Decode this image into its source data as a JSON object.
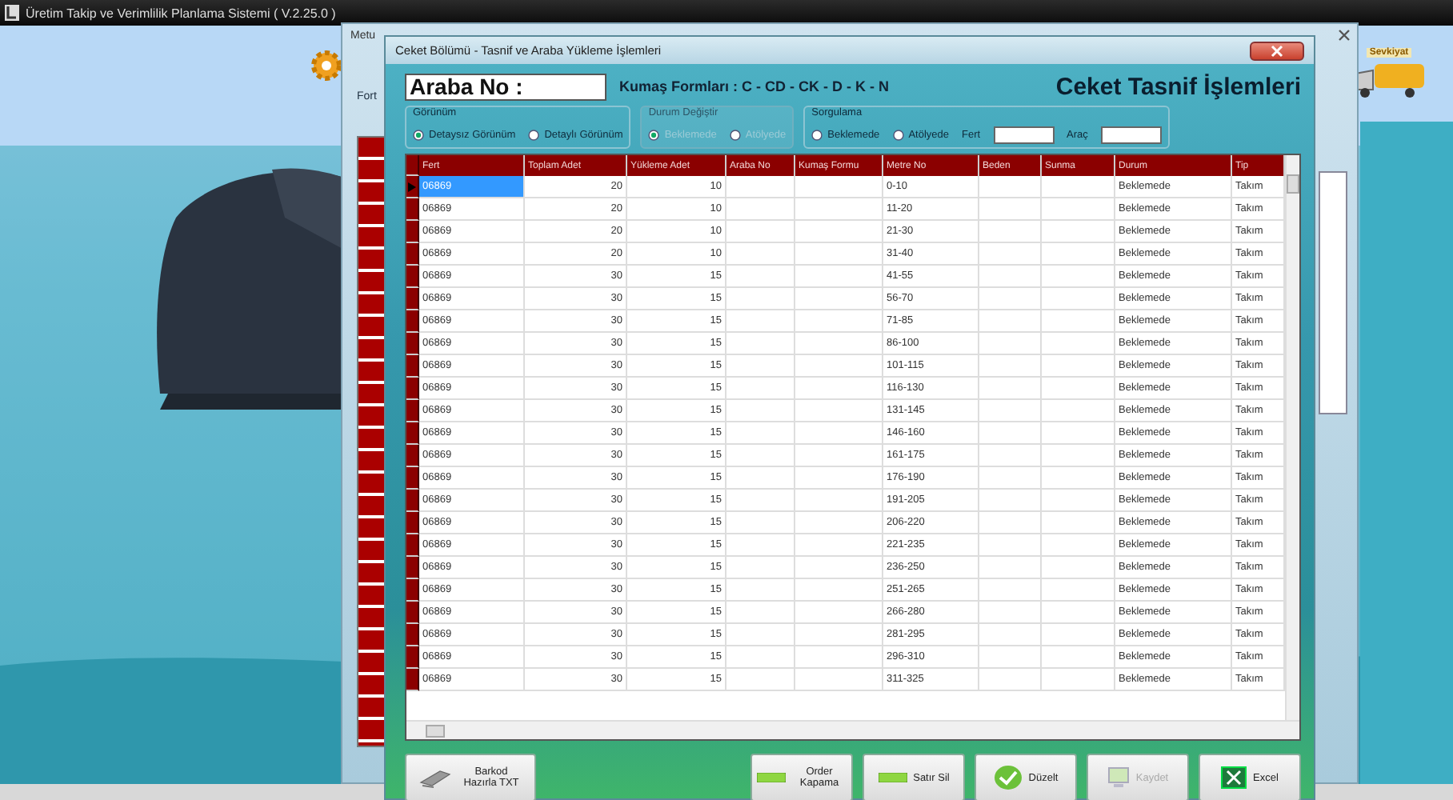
{
  "app_title": "Üretim Takip ve Verimlilik Planlama Sistemi ( V.2.25.0 )",
  "background_window": {
    "title": "Metu",
    "field_label": "Fort"
  },
  "shortcut": {
    "label": "Sevkiyat"
  },
  "dialog": {
    "title": "Ceket Bölümü - Tasnif ve Araba Yükleme İşlemleri",
    "cart_label": "Araba No :",
    "fabric_forms": "Kumaş Formları : C - CD - CK - D - K - N",
    "heading": "Ceket Tasnif İşlemleri"
  },
  "groups": [
    {
      "kind": "radio",
      "title": "Görünüm",
      "disabled": false,
      "options": [
        {
          "label": "Detaysız Görünüm",
          "selected": true
        },
        {
          "label": "Detaylı Görünüm",
          "selected": false
        }
      ]
    },
    {
      "kind": "radio",
      "title": "Durum Değiştir",
      "disabled": true,
      "options": [
        {
          "label": "Beklemede",
          "selected": true
        },
        {
          "label": "Atölyede",
          "selected": false
        }
      ]
    },
    {
      "kind": "query",
      "title": "Sorgulama",
      "disabled": false,
      "options": [
        {
          "label": "Beklemede",
          "selected": false
        },
        {
          "label": "Atölyede",
          "selected": false
        }
      ],
      "fields": [
        {
          "label": "Fert"
        },
        {
          "label": "Araç"
        }
      ]
    }
  ],
  "table": {
    "columns": [
      "Fert",
      "Toplam Adet",
      "Yükleme Adet",
      "Araba No",
      "Kumaş Formu",
      "Metre No",
      "Beden",
      "Sunma",
      "Durum",
      "Tip"
    ],
    "rows": [
      {
        "selected": true,
        "cells": [
          "06869",
          "20",
          "10",
          null,
          null,
          "0-10",
          null,
          null,
          "Beklemede",
          "Takım"
        ]
      },
      {
        "selected": false,
        "cells": [
          "06869",
          "20",
          "10",
          null,
          null,
          "11-20",
          null,
          null,
          "Beklemede",
          "Takım"
        ]
      },
      {
        "selected": false,
        "cells": [
          "06869",
          "20",
          "10",
          null,
          null,
          "21-30",
          null,
          null,
          "Beklemede",
          "Takım"
        ]
      },
      {
        "selected": false,
        "cells": [
          "06869",
          "20",
          "10",
          null,
          null,
          "31-40",
          null,
          null,
          "Beklemede",
          "Takım"
        ]
      },
      {
        "selected": false,
        "cells": [
          "06869",
          "30",
          "15",
          null,
          null,
          "41-55",
          null,
          null,
          "Beklemede",
          "Takım"
        ]
      },
      {
        "selected": false,
        "cells": [
          "06869",
          "30",
          "15",
          null,
          null,
          "56-70",
          null,
          null,
          "Beklemede",
          "Takım"
        ]
      },
      {
        "selected": false,
        "cells": [
          "06869",
          "30",
          "15",
          null,
          null,
          "71-85",
          null,
          null,
          "Beklemede",
          "Takım"
        ]
      },
      {
        "selected": false,
        "cells": [
          "06869",
          "30",
          "15",
          null,
          null,
          "86-100",
          null,
          null,
          "Beklemede",
          "Takım"
        ]
      },
      {
        "selected": false,
        "cells": [
          "06869",
          "30",
          "15",
          null,
          null,
          "101-115",
          null,
          null,
          "Beklemede",
          "Takım"
        ]
      },
      {
        "selected": false,
        "cells": [
          "06869",
          "30",
          "15",
          null,
          null,
          "116-130",
          null,
          null,
          "Beklemede",
          "Takım"
        ]
      },
      {
        "selected": false,
        "cells": [
          "06869",
          "30",
          "15",
          null,
          null,
          "131-145",
          null,
          null,
          "Beklemede",
          "Takım"
        ]
      },
      {
        "selected": false,
        "cells": [
          "06869",
          "30",
          "15",
          null,
          null,
          "146-160",
          null,
          null,
          "Beklemede",
          "Takım"
        ]
      },
      {
        "selected": false,
        "cells": [
          "06869",
          "30",
          "15",
          null,
          null,
          "161-175",
          null,
          null,
          "Beklemede",
          "Takım"
        ]
      },
      {
        "selected": false,
        "cells": [
          "06869",
          "30",
          "15",
          null,
          null,
          "176-190",
          null,
          null,
          "Beklemede",
          "Takım"
        ]
      },
      {
        "selected": false,
        "cells": [
          "06869",
          "30",
          "15",
          null,
          null,
          "191-205",
          null,
          null,
          "Beklemede",
          "Takım"
        ]
      },
      {
        "selected": false,
        "cells": [
          "06869",
          "30",
          "15",
          null,
          null,
          "206-220",
          null,
          null,
          "Beklemede",
          "Takım"
        ]
      },
      {
        "selected": false,
        "cells": [
          "06869",
          "30",
          "15",
          null,
          null,
          "221-235",
          null,
          null,
          "Beklemede",
          "Takım"
        ]
      },
      {
        "selected": false,
        "cells": [
          "06869",
          "30",
          "15",
          null,
          null,
          "236-250",
          null,
          null,
          "Beklemede",
          "Takım"
        ]
      },
      {
        "selected": false,
        "cells": [
          "06869",
          "30",
          "15",
          null,
          null,
          "251-265",
          null,
          null,
          "Beklemede",
          "Takım"
        ]
      },
      {
        "selected": false,
        "cells": [
          "06869",
          "30",
          "15",
          null,
          null,
          "266-280",
          null,
          null,
          "Beklemede",
          "Takım"
        ]
      },
      {
        "selected": false,
        "cells": [
          "06869",
          "30",
          "15",
          null,
          null,
          "281-295",
          null,
          null,
          "Beklemede",
          "Takım"
        ]
      },
      {
        "selected": false,
        "cells": [
          "06869",
          "30",
          "15",
          null,
          null,
          "296-310",
          null,
          null,
          "Beklemede",
          "Takım"
        ]
      },
      {
        "selected": false,
        "cells": [
          "06869",
          "30",
          "15",
          null,
          null,
          "311-325",
          null,
          null,
          "Beklemede",
          "Takım"
        ]
      }
    ]
  },
  "buttons": [
    {
      "kind": "barcode",
      "label": "Barkod Hazırla TXT",
      "disabled": false
    },
    {
      "kind": "bar",
      "label": "Order Kapama",
      "disabled": false
    },
    {
      "kind": "bar",
      "label": "Satır Sil",
      "disabled": false
    },
    {
      "kind": "check",
      "label": "Düzelt",
      "disabled": false
    },
    {
      "kind": "save",
      "label": "Kaydet",
      "disabled": true
    },
    {
      "kind": "excel",
      "label": "Excel",
      "disabled": false
    }
  ]
}
